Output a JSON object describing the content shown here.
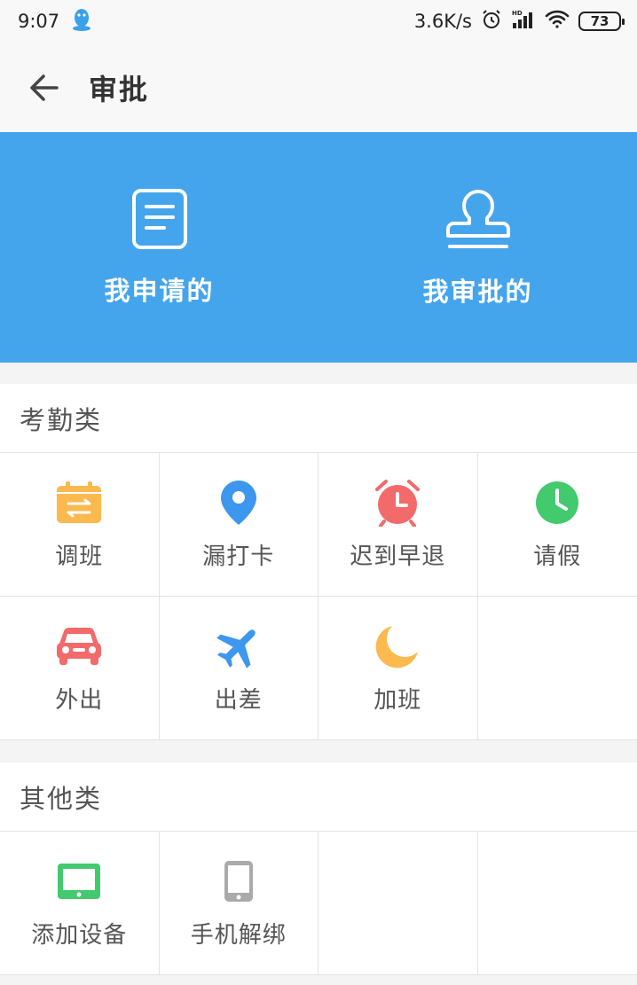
{
  "status": {
    "time": "9:07",
    "speed": "3.6K/s",
    "battery": "73"
  },
  "header": {
    "title": "审批"
  },
  "banner": [
    {
      "label": "我申请的"
    },
    {
      "label": "我审批的"
    }
  ],
  "attendance": {
    "title": "考勤类",
    "items": [
      {
        "label": "调班"
      },
      {
        "label": "漏打卡"
      },
      {
        "label": "迟到早退"
      },
      {
        "label": "请假"
      },
      {
        "label": "外出"
      },
      {
        "label": "出差"
      },
      {
        "label": "加班"
      }
    ]
  },
  "other": {
    "title": "其他类",
    "items": [
      {
        "label": "添加设备"
      },
      {
        "label": "手机解绑"
      }
    ]
  },
  "colors": {
    "banner": "#45a5ec",
    "calendar": "#fbb94e",
    "pin": "#3e97ee",
    "alarm": "#f26a6a",
    "clock": "#43c96e",
    "car": "#f26a6a",
    "plane": "#3e97ee",
    "moon": "#fbb94e",
    "device": "#43c96e",
    "phone": "#aaaaaa"
  }
}
